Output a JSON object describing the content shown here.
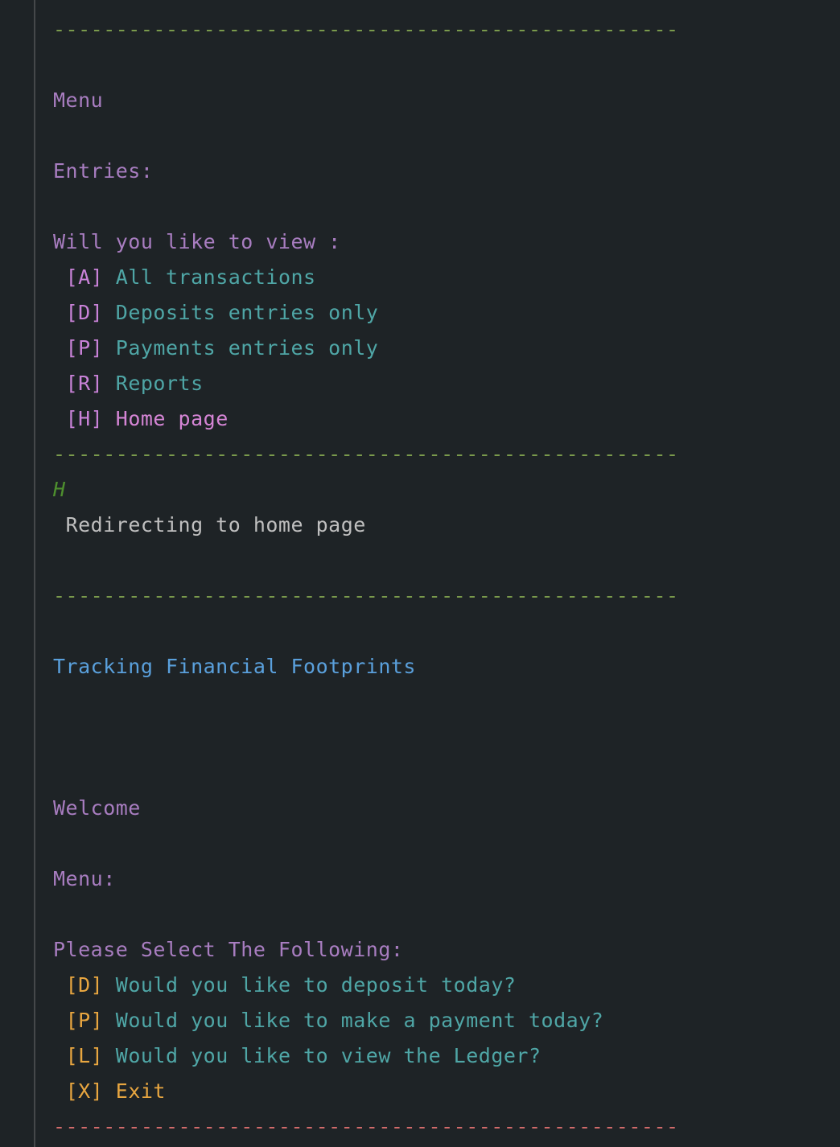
{
  "separator": "--------------------------------------------------",
  "ledger_menu": {
    "title": "Menu",
    "subtitle": "Entries:",
    "prompt": "Will you like to view :",
    "options": [
      {
        "key": "[A]",
        "label": "All transactions"
      },
      {
        "key": "[D]",
        "label": "Deposits entries only"
      },
      {
        "key": "[P]",
        "label": "Payments entries only"
      },
      {
        "key": "[R]",
        "label": "Reports"
      },
      {
        "key": "[H]",
        "label": "Home page"
      }
    ]
  },
  "user_input": "H",
  "redirect_message": "Redirecting to home page",
  "home": {
    "app_title": "Tracking Financial Footprints",
    "welcome": "Welcome",
    "menu_label": "Menu:",
    "prompt": "Please Select The Following:",
    "options": [
      {
        "key": "[D]",
        "label": "Would you like to deposit today?"
      },
      {
        "key": "[P]",
        "label": "Would you like to make a payment today?"
      },
      {
        "key": "[L]",
        "label": "Would you like to view the Ledger?"
      },
      {
        "key": "[X]",
        "label": "Exit"
      }
    ]
  },
  "colors": {
    "background": "#1e2326",
    "separator_green": "#7a9a4c",
    "separator_red": "#d06a6a",
    "heading_purple": "#a87dc0",
    "option_teal": "#4fa6a6",
    "key_orange": "#e8a640",
    "title_blue": "#5aa0dc"
  }
}
